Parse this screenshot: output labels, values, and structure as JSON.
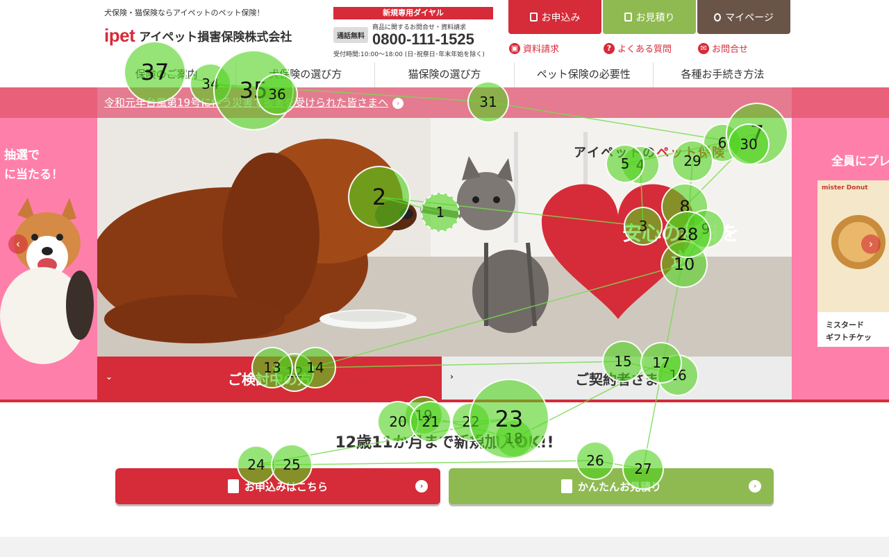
{
  "header": {
    "tagline": "犬保険・猫保険ならアイペットのペット保険！",
    "logo_mark": "ipet",
    "logo_text": "アイペット損害保険株式会社"
  },
  "dial": {
    "title": "新規専用ダイヤル",
    "free_badge": "通話無料",
    "note": "商品に関するお問合せ・資料請求",
    "number": "0800-111-1525",
    "hours": "受付時間:10:00〜18:00 (日･祝祭日･年末年始を除く)"
  },
  "top_buttons": [
    {
      "label": "お申込み",
      "color": "#d62b38"
    },
    {
      "label": "お見積り",
      "color": "#8fba52"
    },
    {
      "label": "マイページ",
      "color": "#6a5448"
    }
  ],
  "sub_links": [
    {
      "label": "資料請求",
      "icon": "book-icon"
    },
    {
      "label": "よくある質問",
      "icon": "question-icon"
    },
    {
      "label": "お問合せ",
      "icon": "mail-icon"
    }
  ],
  "nav": [
    "保険のご案内",
    "犬保険の選び方",
    "猫保険の選び方",
    "ペット保険の必要性",
    "各種お手続き方法"
  ],
  "notice": {
    "text": "令和元年台風第19号に伴う災害で被害を受けられた皆さまへ"
  },
  "hero": {
    "left_side_text": [
      "抽選で",
      "に当たる！"
    ],
    "right_side_text": "全員にプレ",
    "prize_brand": "mister Donut",
    "prize_text": [
      "ミスタード",
      "ギフトチケッ"
    ],
    "copy_top_a": "アイペットの",
    "copy_top_b": "ペット保険",
    "copy_main_a": "安心の毎日を",
    "copy_main_b": "送"
  },
  "tabs": {
    "active": "ご検討中の方",
    "inactive": "ご契約者さま"
  },
  "lower": {
    "age_text": "12歳11か月まで新規加入OK!!",
    "cta_apply": "お申込みはこちら",
    "cta_estimate": "かんたんお見積り"
  },
  "colors": {
    "brand_red": "#d62b38",
    "brand_green": "#8fba52",
    "brand_brown": "#6a5448",
    "banner_pink": "#ff7fab"
  },
  "gaze_fixations": [
    {
      "n": 1,
      "label": "1"
    },
    {
      "n": 2,
      "label": "2"
    },
    {
      "n": 3,
      "label": "3"
    },
    {
      "n": 4,
      "label": "4"
    },
    {
      "n": 5,
      "label": "5"
    },
    {
      "n": 6,
      "label": "6"
    },
    {
      "n": 7,
      "label": "7"
    },
    {
      "n": 8,
      "label": "8"
    },
    {
      "n": 9,
      "label": "9"
    },
    {
      "n": 10,
      "label": "10"
    },
    {
      "n": 12,
      "label": "12"
    },
    {
      "n": 13,
      "label": "13"
    },
    {
      "n": 14,
      "label": "14"
    },
    {
      "n": 15,
      "label": "15"
    },
    {
      "n": 16,
      "label": "16"
    },
    {
      "n": 17,
      "label": "17"
    },
    {
      "n": 18,
      "label": "18"
    },
    {
      "n": 19,
      "label": "19"
    },
    {
      "n": 20,
      "label": "20"
    },
    {
      "n": 21,
      "label": "21"
    },
    {
      "n": 22,
      "label": "22"
    },
    {
      "n": 23,
      "label": "23"
    },
    {
      "n": 24,
      "label": "24"
    },
    {
      "n": 25,
      "label": "25"
    },
    {
      "n": 26,
      "label": "26"
    },
    {
      "n": 27,
      "label": "27"
    },
    {
      "n": 28,
      "label": "28"
    },
    {
      "n": 29,
      "label": "29"
    },
    {
      "n": 30,
      "label": "30"
    },
    {
      "n": 31,
      "label": "31"
    },
    {
      "n": 34,
      "label": "34"
    },
    {
      "n": 35,
      "label": "35"
    },
    {
      "n": 36,
      "label": "36"
    },
    {
      "n": 37,
      "label": "37"
    }
  ]
}
